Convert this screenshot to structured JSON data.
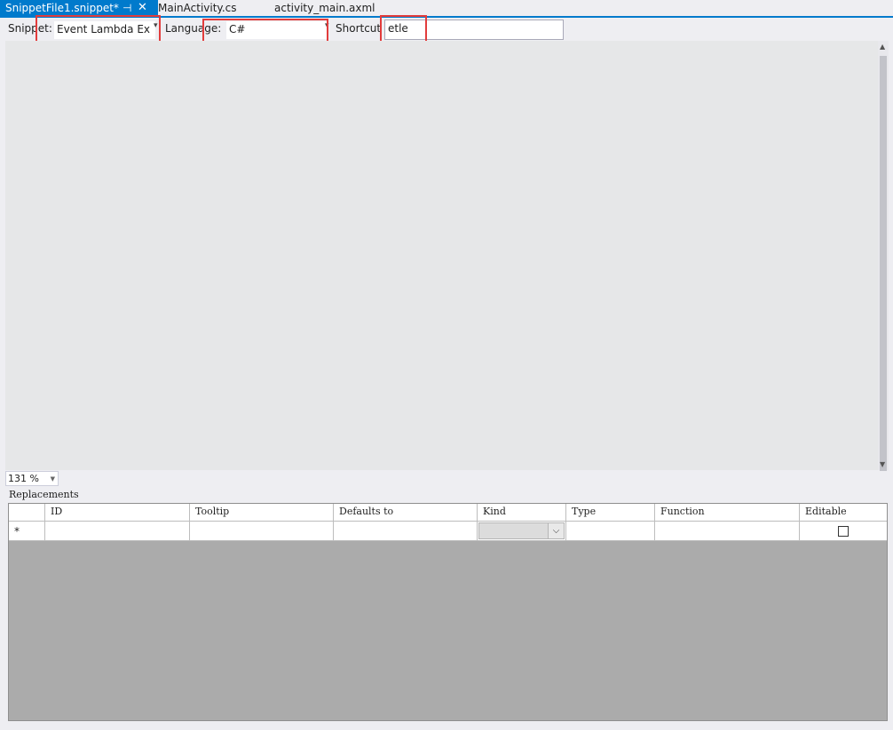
{
  "tabs": [
    {
      "label": "SnippetFile1.snippet*",
      "active": true
    },
    {
      "label": "MainActivity.cs",
      "active": false
    },
    {
      "label": "activity_main.axml",
      "active": false
    }
  ],
  "tab_icons": {
    "pin": "⊣",
    "close": "✕"
  },
  "toolbar": {
    "snippet_label": "Snippet:",
    "snippet_value": "Event Lambda Ex",
    "language_label": "Language:",
    "language_value": "C#",
    "shortcut_label": "Shortcut",
    "shortcut_value": "etle"
  },
  "zoom": {
    "value": "131 %"
  },
  "replacements": {
    "title": "Replacements",
    "columns": [
      "ID",
      "Tooltip",
      "Defaults to",
      "Kind",
      "Type",
      "Function",
      "Editable"
    ],
    "new_row_marker": "*",
    "editable_checked": false
  },
  "colors": {
    "accent": "#007acc",
    "highlight": "#e23c3c",
    "editor_bg": "#e6e7e8",
    "grid_bg": "#ababab"
  }
}
